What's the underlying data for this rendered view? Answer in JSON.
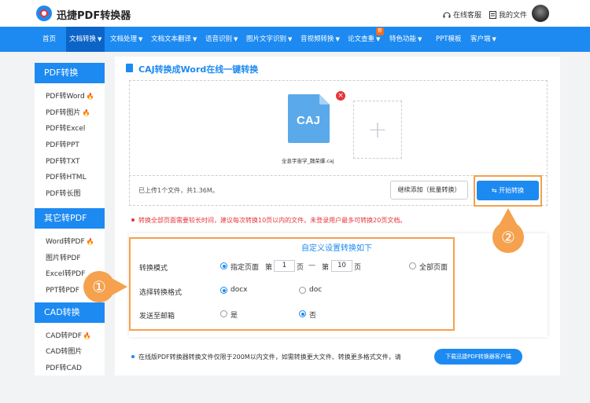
{
  "header": {
    "brand": "迅捷PDF转换器",
    "service": "在线客服",
    "my_files": "我的文件"
  },
  "nav": {
    "items": [
      {
        "label": "首页",
        "caret": false
      },
      {
        "label": "文档转换",
        "caret": true,
        "active": true
      },
      {
        "label": "文档处理",
        "caret": true
      },
      {
        "label": "文档文本翻译",
        "caret": true
      },
      {
        "label": "语音识别",
        "caret": true
      },
      {
        "label": "图片文字识别",
        "caret": true
      },
      {
        "label": "音视频转换",
        "caret": true
      },
      {
        "label": "论文查重",
        "caret": true
      },
      {
        "label": "特色功能",
        "caret": true
      },
      {
        "label": "PPT模板",
        "caret": false
      },
      {
        "label": "客户端",
        "caret": true
      }
    ],
    "badge": "新",
    "accent": "#1d8af1"
  },
  "sidebar": {
    "groups": [
      {
        "title": "PDF转换",
        "items": [
          {
            "label": "PDF转Word",
            "hot": true
          },
          {
            "label": "PDF转图片",
            "hot": true
          },
          {
            "label": "PDF转Excel",
            "hot": false
          },
          {
            "label": "PDF转PPT",
            "hot": false
          },
          {
            "label": "PDF转TXT",
            "hot": false
          },
          {
            "label": "PDF转HTML",
            "hot": false
          },
          {
            "label": "PDF转长图",
            "hot": false
          }
        ]
      },
      {
        "title": "其它转PDF",
        "items": [
          {
            "label": "Word转PDF",
            "hot": true
          },
          {
            "label": "图片转PDF",
            "hot": false
          },
          {
            "label": "Excel转PDF",
            "hot": false
          },
          {
            "label": "PPT转PDF",
            "hot": false
          }
        ]
      },
      {
        "title": "CAD转换",
        "items": [
          {
            "label": "CAD转PDF",
            "hot": true
          },
          {
            "label": "CAD转图片",
            "hot": false
          },
          {
            "label": "PDF转CAD",
            "hot": false
          }
        ]
      }
    ]
  },
  "main": {
    "title": "CAJ转换成Word在线一键转换",
    "file": {
      "ext": "CAJ",
      "name": "全息宇宙学_魏荣爆.caj"
    },
    "upload_info": "已上传1个文件，共1.36M。",
    "continue_button": "继续添加（批量转换）",
    "start_button": "开始转换",
    "warning": "转换全部页面需要较长时间，建议每次转换10页以内的文件。未登录用户最多可转换20页文档。",
    "settings": {
      "title": "自定义设置转换如下",
      "mode_label": "转换模式",
      "mode_options": [
        "指定页面",
        "全部页面"
      ],
      "mode_selected": "指定页面",
      "page_prefix": "第",
      "page_suffix": "页",
      "page_dash": "—",
      "page_from": "1",
      "page_to": "10",
      "format_label": "选择转换格式",
      "format_options": [
        "docx",
        "doc"
      ],
      "format_selected": "docx",
      "email_label": "发送至邮箱",
      "email_options": [
        "是",
        "否"
      ],
      "email_selected": "否"
    },
    "footnote": "在线版PDF转换器转换文件仅限于200M以内文件，如需转换更大文件、转换更多格式文件，请",
    "download_button": "下载迅捷PDF转换器客户端"
  },
  "callouts": [
    "①",
    "②"
  ],
  "colors": {
    "accent": "#1d8af1",
    "highlight": "#f5a14d",
    "warn": "#e5353b"
  }
}
